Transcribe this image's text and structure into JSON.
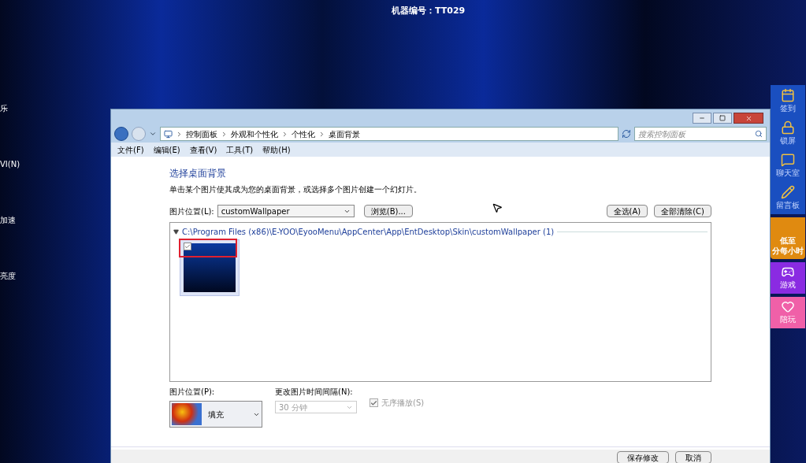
{
  "machine_label": "机器编号：TT029",
  "desktop_icons": [
    {
      "label": "乐"
    },
    {
      "label": "VI(N)"
    },
    {
      "label": "加速"
    },
    {
      "label": "亮度"
    }
  ],
  "window": {
    "breadcrumb": [
      "控制面板",
      "外观和个性化",
      "个性化",
      "桌面背景"
    ],
    "search": {
      "placeholder": "搜索控制面板"
    },
    "menu": [
      "文件(F)",
      "编辑(E)",
      "查看(V)",
      "工具(T)",
      "帮助(H)"
    ],
    "heading": "选择桌面背景",
    "description": "单击某个图片使其成为您的桌面背景，或选择多个图片创建一个幻灯片。",
    "location": {
      "label": "图片位置(L):",
      "value": "customWallpaper",
      "browse": "浏览(B)..."
    },
    "select_all": "全选(A)",
    "clear_all": "全部清除(C)",
    "group": {
      "title": "C:\\Program Files (x86)\\E-YOO\\EyooMenu\\AppCenter\\App\\EntDesktop\\Skin\\customWallpaper (1)",
      "expanded": true,
      "images": [
        {
          "checked": true,
          "selected": true
        }
      ]
    },
    "position": {
      "label": "图片位置(P):",
      "value": "填充"
    },
    "interval": {
      "label": "更改图片时间间隔(N):",
      "value": "30 分钟",
      "disabled": true
    },
    "shuffle": {
      "label": "无序播放(S)",
      "checked": true,
      "disabled": true
    },
    "buttons": [
      "保存修改",
      "取消"
    ]
  },
  "sidebar": [
    {
      "kind": "tool",
      "label": "签到"
    },
    {
      "kind": "tool",
      "label": "锁屏"
    },
    {
      "kind": "tool",
      "label": "聊天室"
    },
    {
      "kind": "tool",
      "label": "留言板"
    },
    {
      "kind": "promo",
      "lines": [
        "低至",
        "分每小时"
      ]
    },
    {
      "kind": "tile",
      "label": "游戏",
      "color": "#8a2be2"
    },
    {
      "kind": "tile",
      "label": "陪玩",
      "color": "#f060a8"
    }
  ]
}
